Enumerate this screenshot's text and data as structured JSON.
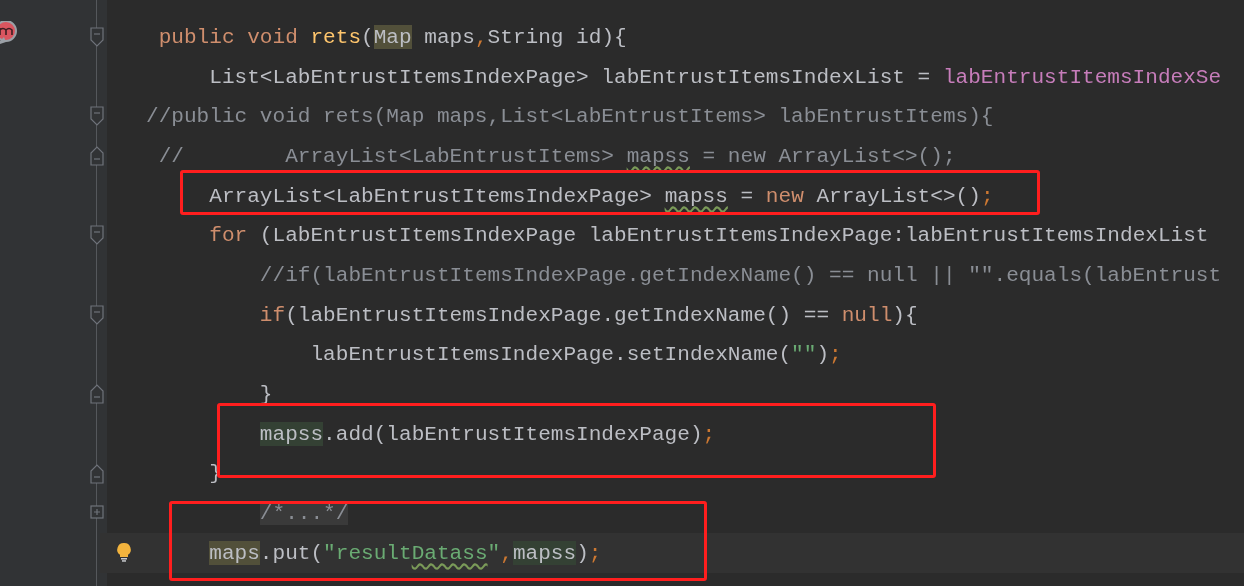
{
  "editor": {
    "lines": [
      {
        "kind": "opener",
        "method_marker": true,
        "bulb": false,
        "current": false,
        "tokens": [
          {
            "kind": "kw",
            "t": " public void "
          },
          {
            "kind": "fn",
            "t": "rets"
          },
          {
            "kind": "plain",
            "t": "("
          },
          {
            "kind": "plain",
            "t": "Map",
            "color": "#52503a"
          },
          {
            "kind": "plain",
            "t": " maps"
          },
          {
            "kind": "punct",
            "t": ","
          },
          {
            "kind": "plain",
            "t": "String id){"
          }
        ]
      },
      {
        "kind": "plain",
        "method_marker": false,
        "bulb": false,
        "current": false,
        "tokens": [
          {
            "kind": "plain",
            "t": "     List<LabEntrustItemsIndexPage> labEntrustItemsIndexList = "
          },
          {
            "kind": "field",
            "t": "labEntrustItemsIndexSe"
          }
        ]
      },
      {
        "kind": "opener",
        "method_marker": false,
        "bulb": false,
        "current": false,
        "tokens": [
          {
            "kind": "comment",
            "t": "//public void rets(Map maps,List<LabEntrustItems> labEntrustItems){"
          }
        ]
      },
      {
        "kind": "closer",
        "method_marker": false,
        "bulb": false,
        "current": false,
        "tokens": [
          {
            "kind": "comment",
            "t": " //        ArrayList<LabEntrustItems> "
          },
          {
            "kind": "comment",
            "t": "mapss",
            "underlined": true
          },
          {
            "kind": "comment",
            "t": " = new ArrayList<>();"
          }
        ]
      },
      {
        "kind": "plain",
        "method_marker": false,
        "bulb": false,
        "current": false,
        "tokens": [
          {
            "kind": "plain",
            "t": "     ArrayList<LabEntrustItemsIndexPage> "
          },
          {
            "kind": "plain",
            "t": "mapss",
            "underlined": true
          },
          {
            "kind": "plain",
            "t": " = "
          },
          {
            "kind": "kw",
            "t": "new"
          },
          {
            "kind": "plain",
            "t": " ArrayList<>()"
          },
          {
            "kind": "punct",
            "t": ";"
          }
        ]
      },
      {
        "kind": "opener",
        "method_marker": false,
        "bulb": false,
        "current": false,
        "tokens": [
          {
            "kind": "kw",
            "t": "     for"
          },
          {
            "kind": "plain",
            "t": " (LabEntrustItemsIndexPage labEntrustItemsIndexPage:labEntrustItemsIndexList"
          }
        ]
      },
      {
        "kind": "plain",
        "method_marker": false,
        "bulb": false,
        "current": false,
        "tokens": [
          {
            "kind": "comment",
            "t": "         //if(labEntrustItemsIndexPage.getIndexName() == null || \"\".equals(labEntrust"
          }
        ]
      },
      {
        "kind": "opener",
        "method_marker": false,
        "bulb": false,
        "current": false,
        "tokens": [
          {
            "kind": "kw",
            "t": "         if"
          },
          {
            "kind": "plain",
            "t": "(labEntrustItemsIndexPage.getIndexName() == "
          },
          {
            "kind": "kw",
            "t": "null"
          },
          {
            "kind": "plain",
            "t": "){"
          }
        ]
      },
      {
        "kind": "plain",
        "method_marker": false,
        "bulb": false,
        "current": false,
        "tokens": [
          {
            "kind": "plain",
            "t": "             labEntrustItemsIndexPage.setIndexName("
          },
          {
            "kind": "str",
            "t": "\"\""
          },
          {
            "kind": "plain",
            "t": ")"
          },
          {
            "kind": "punct",
            "t": ";"
          }
        ]
      },
      {
        "kind": "closer",
        "method_marker": false,
        "bulb": false,
        "current": false,
        "tokens": [
          {
            "kind": "plain",
            "t": "         }"
          }
        ]
      },
      {
        "kind": "plain",
        "method_marker": false,
        "bulb": false,
        "current": false,
        "tokens": [
          {
            "kind": "plain",
            "t": "         mapss",
            "color": "#344134"
          },
          {
            "kind": "plain",
            "t": ".add(labEntrustItemsIndexPage)"
          },
          {
            "kind": "punct",
            "t": ";"
          }
        ]
      },
      {
        "kind": "closer",
        "method_marker": false,
        "bulb": false,
        "current": false,
        "tokens": [
          {
            "kind": "plain",
            "t": "     }"
          }
        ]
      },
      {
        "kind": "folded",
        "method_marker": false,
        "bulb": false,
        "current": false,
        "tokens": [
          {
            "kind": "comment",
            "t": "         /*...*/",
            "color": "#3a3a3a"
          }
        ]
      },
      {
        "kind": "plain",
        "method_marker": false,
        "bulb": true,
        "current": true,
        "tokens": [
          {
            "kind": "plain",
            "t": "     maps",
            "color": "#52503a"
          },
          {
            "kind": "plain",
            "t": ".put("
          },
          {
            "kind": "str",
            "t": "\"result"
          },
          {
            "kind": "str",
            "t": "Datass",
            "underlined": true
          },
          {
            "kind": "str",
            "t": "\""
          },
          {
            "kind": "punct",
            "t": ","
          },
          {
            "kind": "plain",
            "t": "mapss",
            "color": "#344134"
          },
          {
            "kind": "plain",
            "t": ")"
          },
          {
            "kind": "punct",
            "t": ";"
          }
        ]
      }
    ]
  },
  "annotations": [
    {
      "kind": "rect"
    },
    {
      "kind": "rect"
    },
    {
      "kind": "rect"
    }
  ]
}
